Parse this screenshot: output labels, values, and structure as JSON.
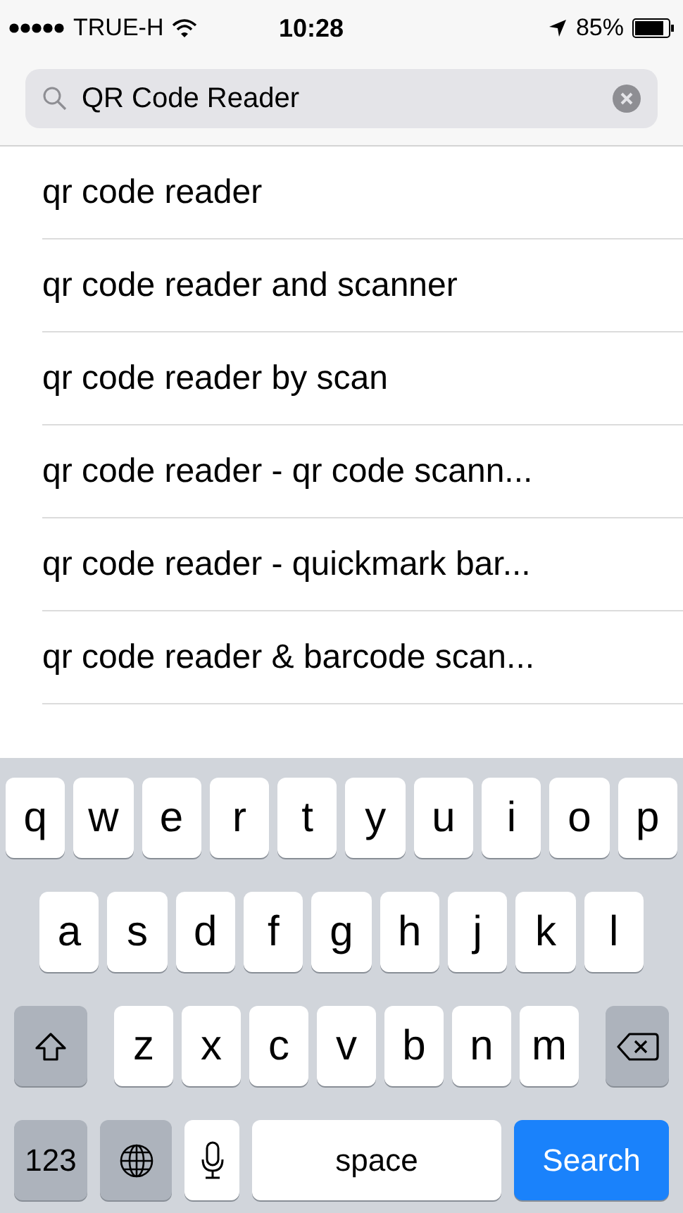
{
  "status_bar": {
    "carrier": "TRUE-H",
    "time": "10:28",
    "battery": "85%"
  },
  "search": {
    "value": "QR Code Reader"
  },
  "suggestions": [
    "qr code reader",
    "qr code reader and scanner",
    "qr code reader by scan",
    "qr code reader - qr code scann...",
    "qr code reader - quickmark bar...",
    "qr code reader & barcode scan..."
  ],
  "keyboard": {
    "rows": [
      [
        "q",
        "w",
        "e",
        "r",
        "t",
        "y",
        "u",
        "i",
        "o",
        "p"
      ],
      [
        "a",
        "s",
        "d",
        "f",
        "g",
        "h",
        "j",
        "k",
        "l"
      ],
      [
        "z",
        "x",
        "c",
        "v",
        "b",
        "n",
        "m"
      ]
    ],
    "numbers_key": "123",
    "space_key": "space",
    "return_key": "Search"
  }
}
